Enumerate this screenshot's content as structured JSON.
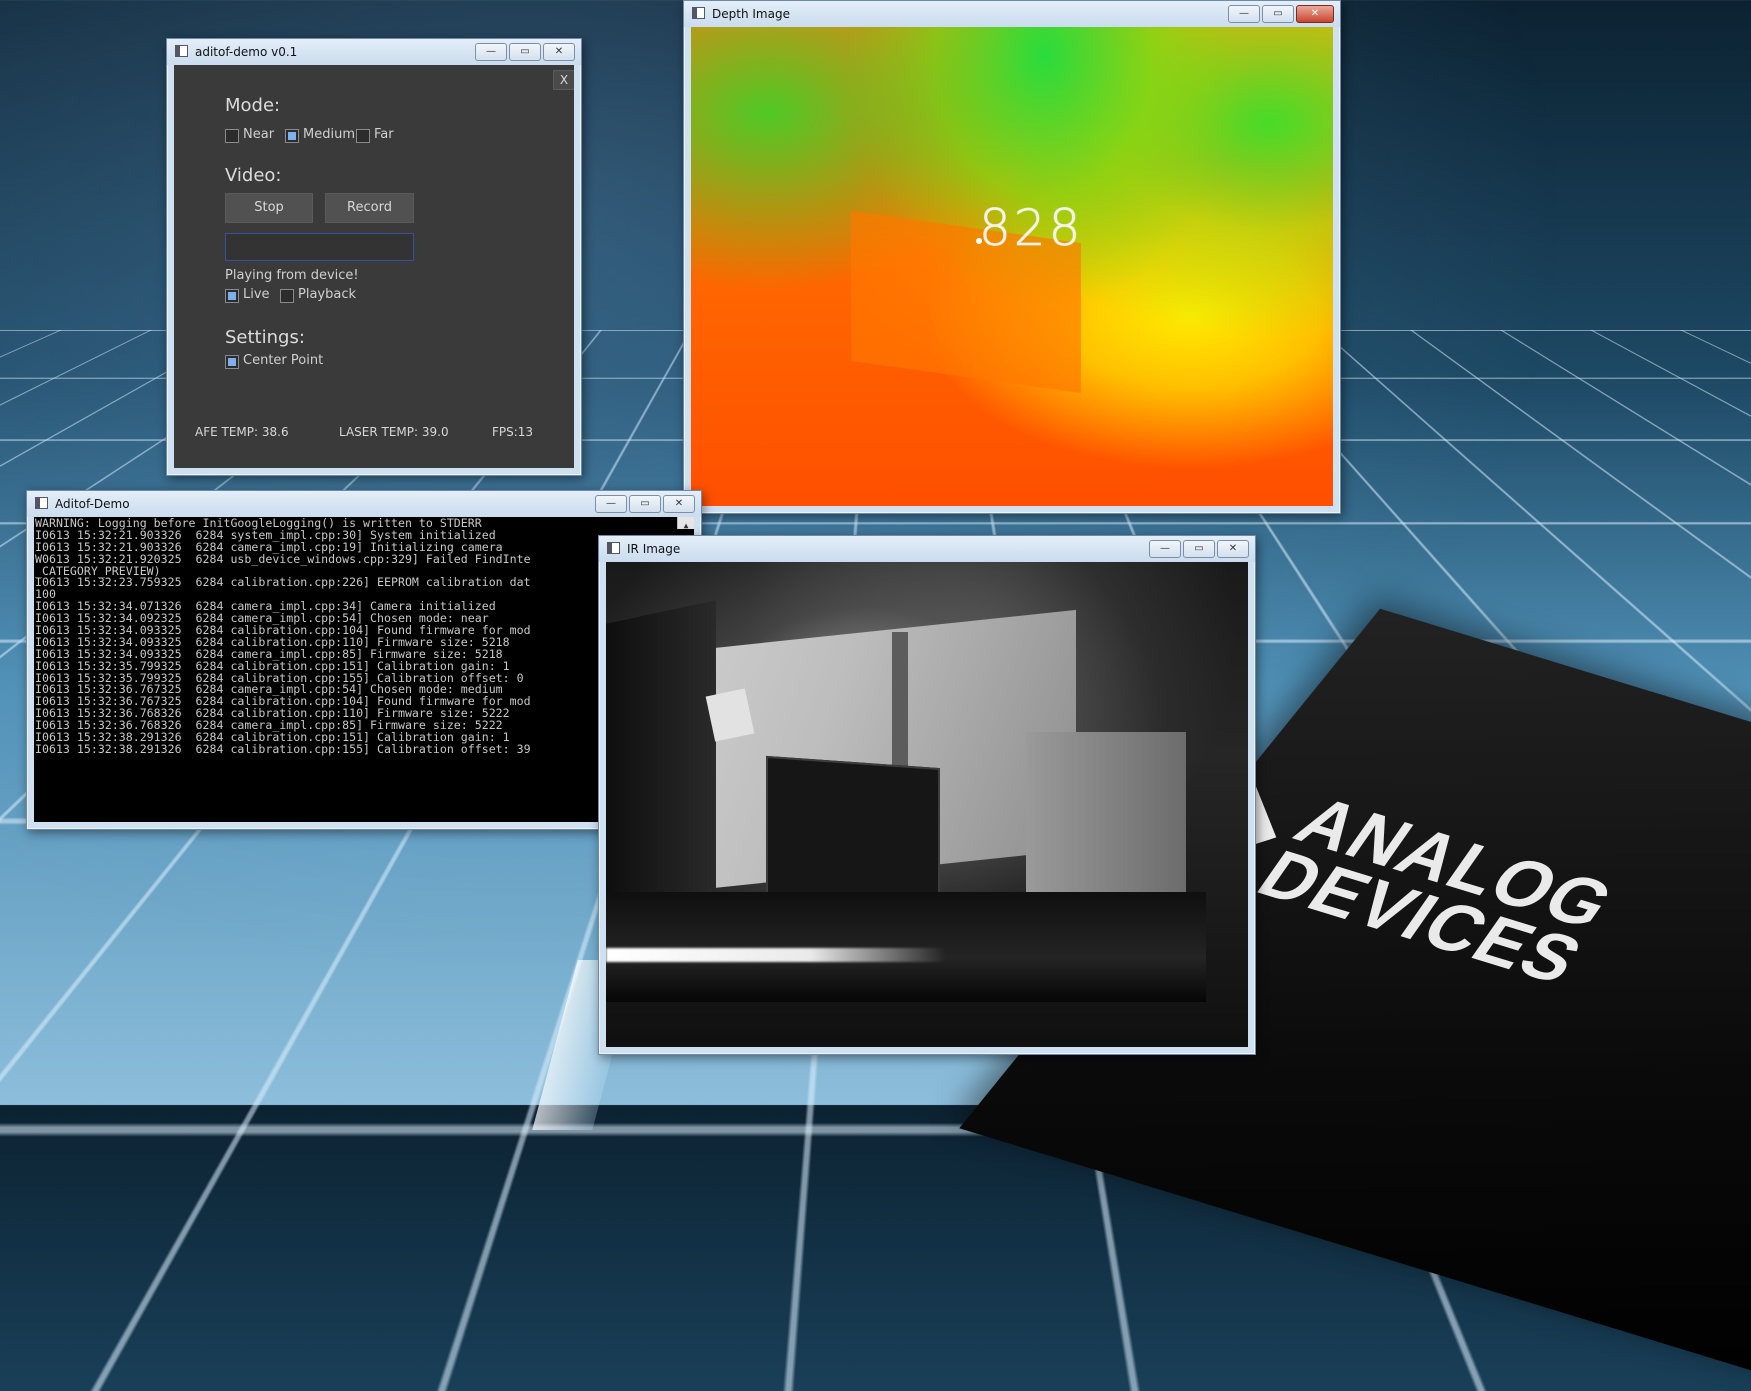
{
  "windows": {
    "control": {
      "title": "aditof-demo v0.1",
      "close_x": "X",
      "mode": {
        "heading": "Mode:",
        "options": [
          {
            "label": "Near",
            "checked": false
          },
          {
            "label": "Medium",
            "checked": true
          },
          {
            "label": "Far",
            "checked": false
          }
        ]
      },
      "video": {
        "heading": "Video:",
        "stop_label": "Stop",
        "record_label": "Record",
        "filename_value": "",
        "status_text": "Playing from device!",
        "sources": [
          {
            "label": "Live",
            "checked": true
          },
          {
            "label": "Playback",
            "checked": false
          }
        ]
      },
      "settings": {
        "heading": "Settings:",
        "center_point": {
          "label": "Center Point",
          "checked": true
        }
      },
      "statusbar": {
        "afe_temp": "AFE TEMP: 38.6",
        "laser_temp": "LASER TEMP: 39.0",
        "fps": "FPS:13"
      }
    },
    "console": {
      "title": "Aditof-Demo",
      "lines": [
        "WARNING: Logging before InitGoogleLogging() is written to STDERR",
        "I0613 15:32:21.903326  6284 system_impl.cpp:30] System initialized",
        "I0613 15:32:21.903326  6284 camera_impl.cpp:19] Initializing camera",
        "W0613 15:32:21.920325  6284 usb_device_windows.cpp:329] Failed FindInte",
        "_CATEGORY_PREVIEW)",
        "I0613 15:32:23.759325  6284 calibration.cpp:226] EEPROM calibration dat",
        "100",
        "I0613 15:32:34.071326  6284 camera_impl.cpp:34] Camera initialized",
        "I0613 15:32:34.092325  6284 camera_impl.cpp:54] Chosen mode: near",
        "I0613 15:32:34.093325  6284 calibration.cpp:104] Found firmware for mod",
        "I0613 15:32:34.093325  6284 calibration.cpp:110] Firmware size: 5218",
        "I0613 15:32:34.093325  6284 camera_impl.cpp:85] Firmware size: 5218",
        "I0613 15:32:35.799325  6284 calibration.cpp:151] Calibration gain: 1",
        "I0613 15:32:35.799325  6284 calibration.cpp:155] Calibration offset: 0",
        "I0613 15:32:36.767325  6284 camera_impl.cpp:54] Chosen mode: medium",
        "I0613 15:32:36.767325  6284 calibration.cpp:104] Found firmware for mod",
        "I0613 15:32:36.768326  6284 calibration.cpp:110] Firmware size: 5222",
        "I0613 15:32:36.768326  6284 camera_impl.cpp:85] Firmware size: 5222",
        "I0613 15:32:38.291326  6284 calibration.cpp:151] Calibration gain: 1",
        "I0613 15:32:38.291326  6284 calibration.cpp:155] Calibration offset: 39"
      ]
    },
    "depth": {
      "title": "Depth Image",
      "center_value": "828"
    },
    "ir": {
      "title": "IR Image"
    }
  },
  "caption_buttons": {
    "minimize": "—",
    "maximize": "▭",
    "close": "✕"
  },
  "desktop": {
    "logo_line1": "ANALOG",
    "logo_line2": "DEVICES"
  },
  "colors": {
    "panel_bg": "#3a3a3a",
    "checkbox_accent": "#7fb0ee",
    "field_border": "#3b4f9e",
    "depth_near": "#ff5000",
    "depth_far": "#20d040"
  }
}
